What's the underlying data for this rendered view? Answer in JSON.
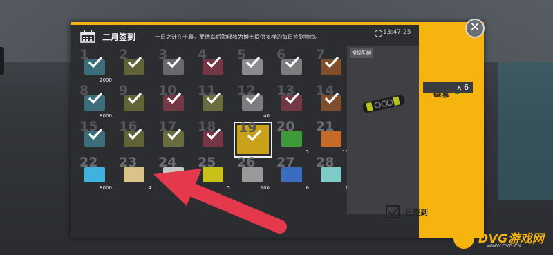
{
  "header": {
    "title": "二月签到",
    "subtitle": "一日之计在于晨。罗德岛后勤部将为博士提供多样的每日签到物资。"
  },
  "clock": {
    "time": "13:47:25"
  },
  "reward": {
    "tag": "常规配給",
    "name": "碳素",
    "qty": "x 6"
  },
  "status": {
    "signed_label": "已签到"
  },
  "watermark": {
    "brand": "DVG游戏网",
    "url": "WWW.DVG.CN"
  },
  "days": [
    {
      "n": "1",
      "qty": "2000",
      "claimed": true,
      "color": "#4aa3b8"
    },
    {
      "n": "2",
      "qty": "",
      "claimed": true,
      "color": "#8a8f3a"
    },
    {
      "n": "3",
      "qty": "",
      "claimed": true,
      "color": "#9a9a9a"
    },
    {
      "n": "4",
      "qty": "",
      "claimed": true,
      "color": "#b0405a"
    },
    {
      "n": "5",
      "qty": "",
      "claimed": true,
      "color": "#d8d8d8"
    },
    {
      "n": "6",
      "qty": "",
      "claimed": true,
      "color": "#bfbfbf"
    },
    {
      "n": "7",
      "qty": "",
      "claimed": true,
      "color": "#c46a2a"
    },
    {
      "n": "8",
      "qty": "8000",
      "claimed": true,
      "color": "#4aa3b8"
    },
    {
      "n": "9",
      "qty": "",
      "claimed": true,
      "color": "#8a8f3a"
    },
    {
      "n": "10",
      "qty": "",
      "claimed": true,
      "color": "#b0405a"
    },
    {
      "n": "11",
      "qty": "",
      "claimed": true,
      "color": "#9aa04a"
    },
    {
      "n": "12",
      "qty": "40",
      "claimed": true,
      "color": "#bfbfbf"
    },
    {
      "n": "13",
      "qty": "",
      "claimed": true,
      "color": "#b0405a"
    },
    {
      "n": "14",
      "qty": "",
      "claimed": true,
      "color": "#c46a2a"
    },
    {
      "n": "15",
      "qty": "",
      "claimed": true,
      "color": "#4aa3b8"
    },
    {
      "n": "16",
      "qty": "",
      "claimed": true,
      "color": "#8a8f3a"
    },
    {
      "n": "17",
      "qty": "",
      "claimed": true,
      "color": "#9aa04a"
    },
    {
      "n": "18",
      "qty": "",
      "claimed": true,
      "color": "#b0405a"
    },
    {
      "n": "19",
      "qty": "",
      "claimed": true,
      "today": true,
      "color": "#c9a21a"
    },
    {
      "n": "20",
      "qty": "5",
      "claimed": false,
      "color": "#3f9a3a"
    },
    {
      "n": "21",
      "qty": "15",
      "claimed": false,
      "color": "#c46a2a"
    },
    {
      "n": "22",
      "qty": "8000",
      "claimed": false,
      "color": "#3fb2e0"
    },
    {
      "n": "23",
      "qty": "4",
      "claimed": false,
      "color": "#d9c38a"
    },
    {
      "n": "24",
      "qty": "",
      "claimed": false,
      "color": "#c8c8c8"
    },
    {
      "n": "25",
      "qty": "5",
      "claimed": false,
      "color": "#c9c01a"
    },
    {
      "n": "26",
      "qty": "100",
      "claimed": false,
      "color": "#9a9a9a"
    },
    {
      "n": "27",
      "qty": "6",
      "claimed": false,
      "color": "#3a6cc0"
    },
    {
      "n": "28",
      "qty": "1",
      "claimed": false,
      "color": "#7fc9c6"
    }
  ]
}
